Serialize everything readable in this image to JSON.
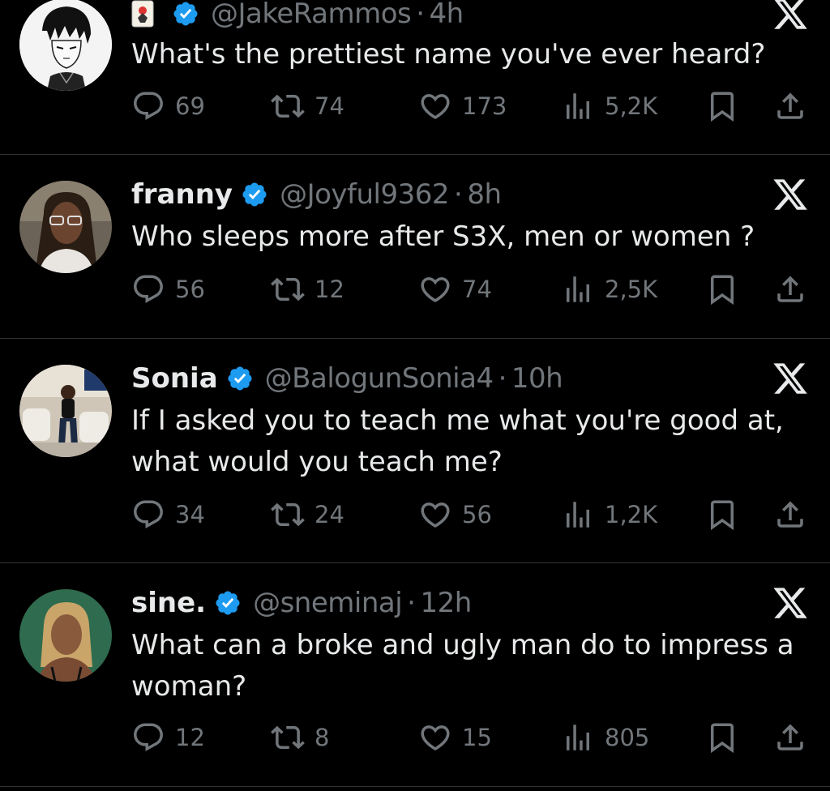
{
  "tweets": [
    {
      "name": "",
      "handle": "@JakeRammos",
      "time": "4h",
      "text": "What's the prettiest name you've ever heard?",
      "replies": "69",
      "reposts": "74",
      "likes": "173",
      "views": "5,2K",
      "avatar": "anime-avatar",
      "badge": "joker-card-emoji"
    },
    {
      "name": "franny",
      "handle": "@Joyful9362",
      "time": "8h",
      "text": "Who sleeps more after S3X, men or women ?",
      "replies": "56",
      "reposts": "12",
      "likes": "74",
      "views": "2,5K",
      "avatar": "photo-avatar"
    },
    {
      "name": "Sonia",
      "handle": "@BalogunSonia4",
      "time": "10h",
      "text": "If I asked you to teach me what you're good at, what would you teach me?",
      "replies": "34",
      "reposts": "24",
      "likes": "56",
      "views": "1,2K",
      "avatar": "photo-avatar"
    },
    {
      "name": "sine.",
      "handle": "@sneminaj",
      "time": "12h",
      "text": "What can a broke and ugly man do to impress a woman?",
      "replies": "12",
      "reposts": "8",
      "likes": "15",
      "views": "805",
      "avatar": "photo-avatar"
    }
  ],
  "separator": "·",
  "icons": {
    "reply": "reply-icon",
    "repost": "repost-icon",
    "like": "heart-icon",
    "views": "views-icon",
    "bookmark": "bookmark-icon",
    "share": "share-icon",
    "verified": "verified-badge-icon",
    "x": "x-logo-icon"
  },
  "colors": {
    "background": "#000000",
    "text": "#e7e9ea",
    "muted": "#71767b",
    "verified": "#1d9bf0",
    "divider": "#2f3336"
  }
}
